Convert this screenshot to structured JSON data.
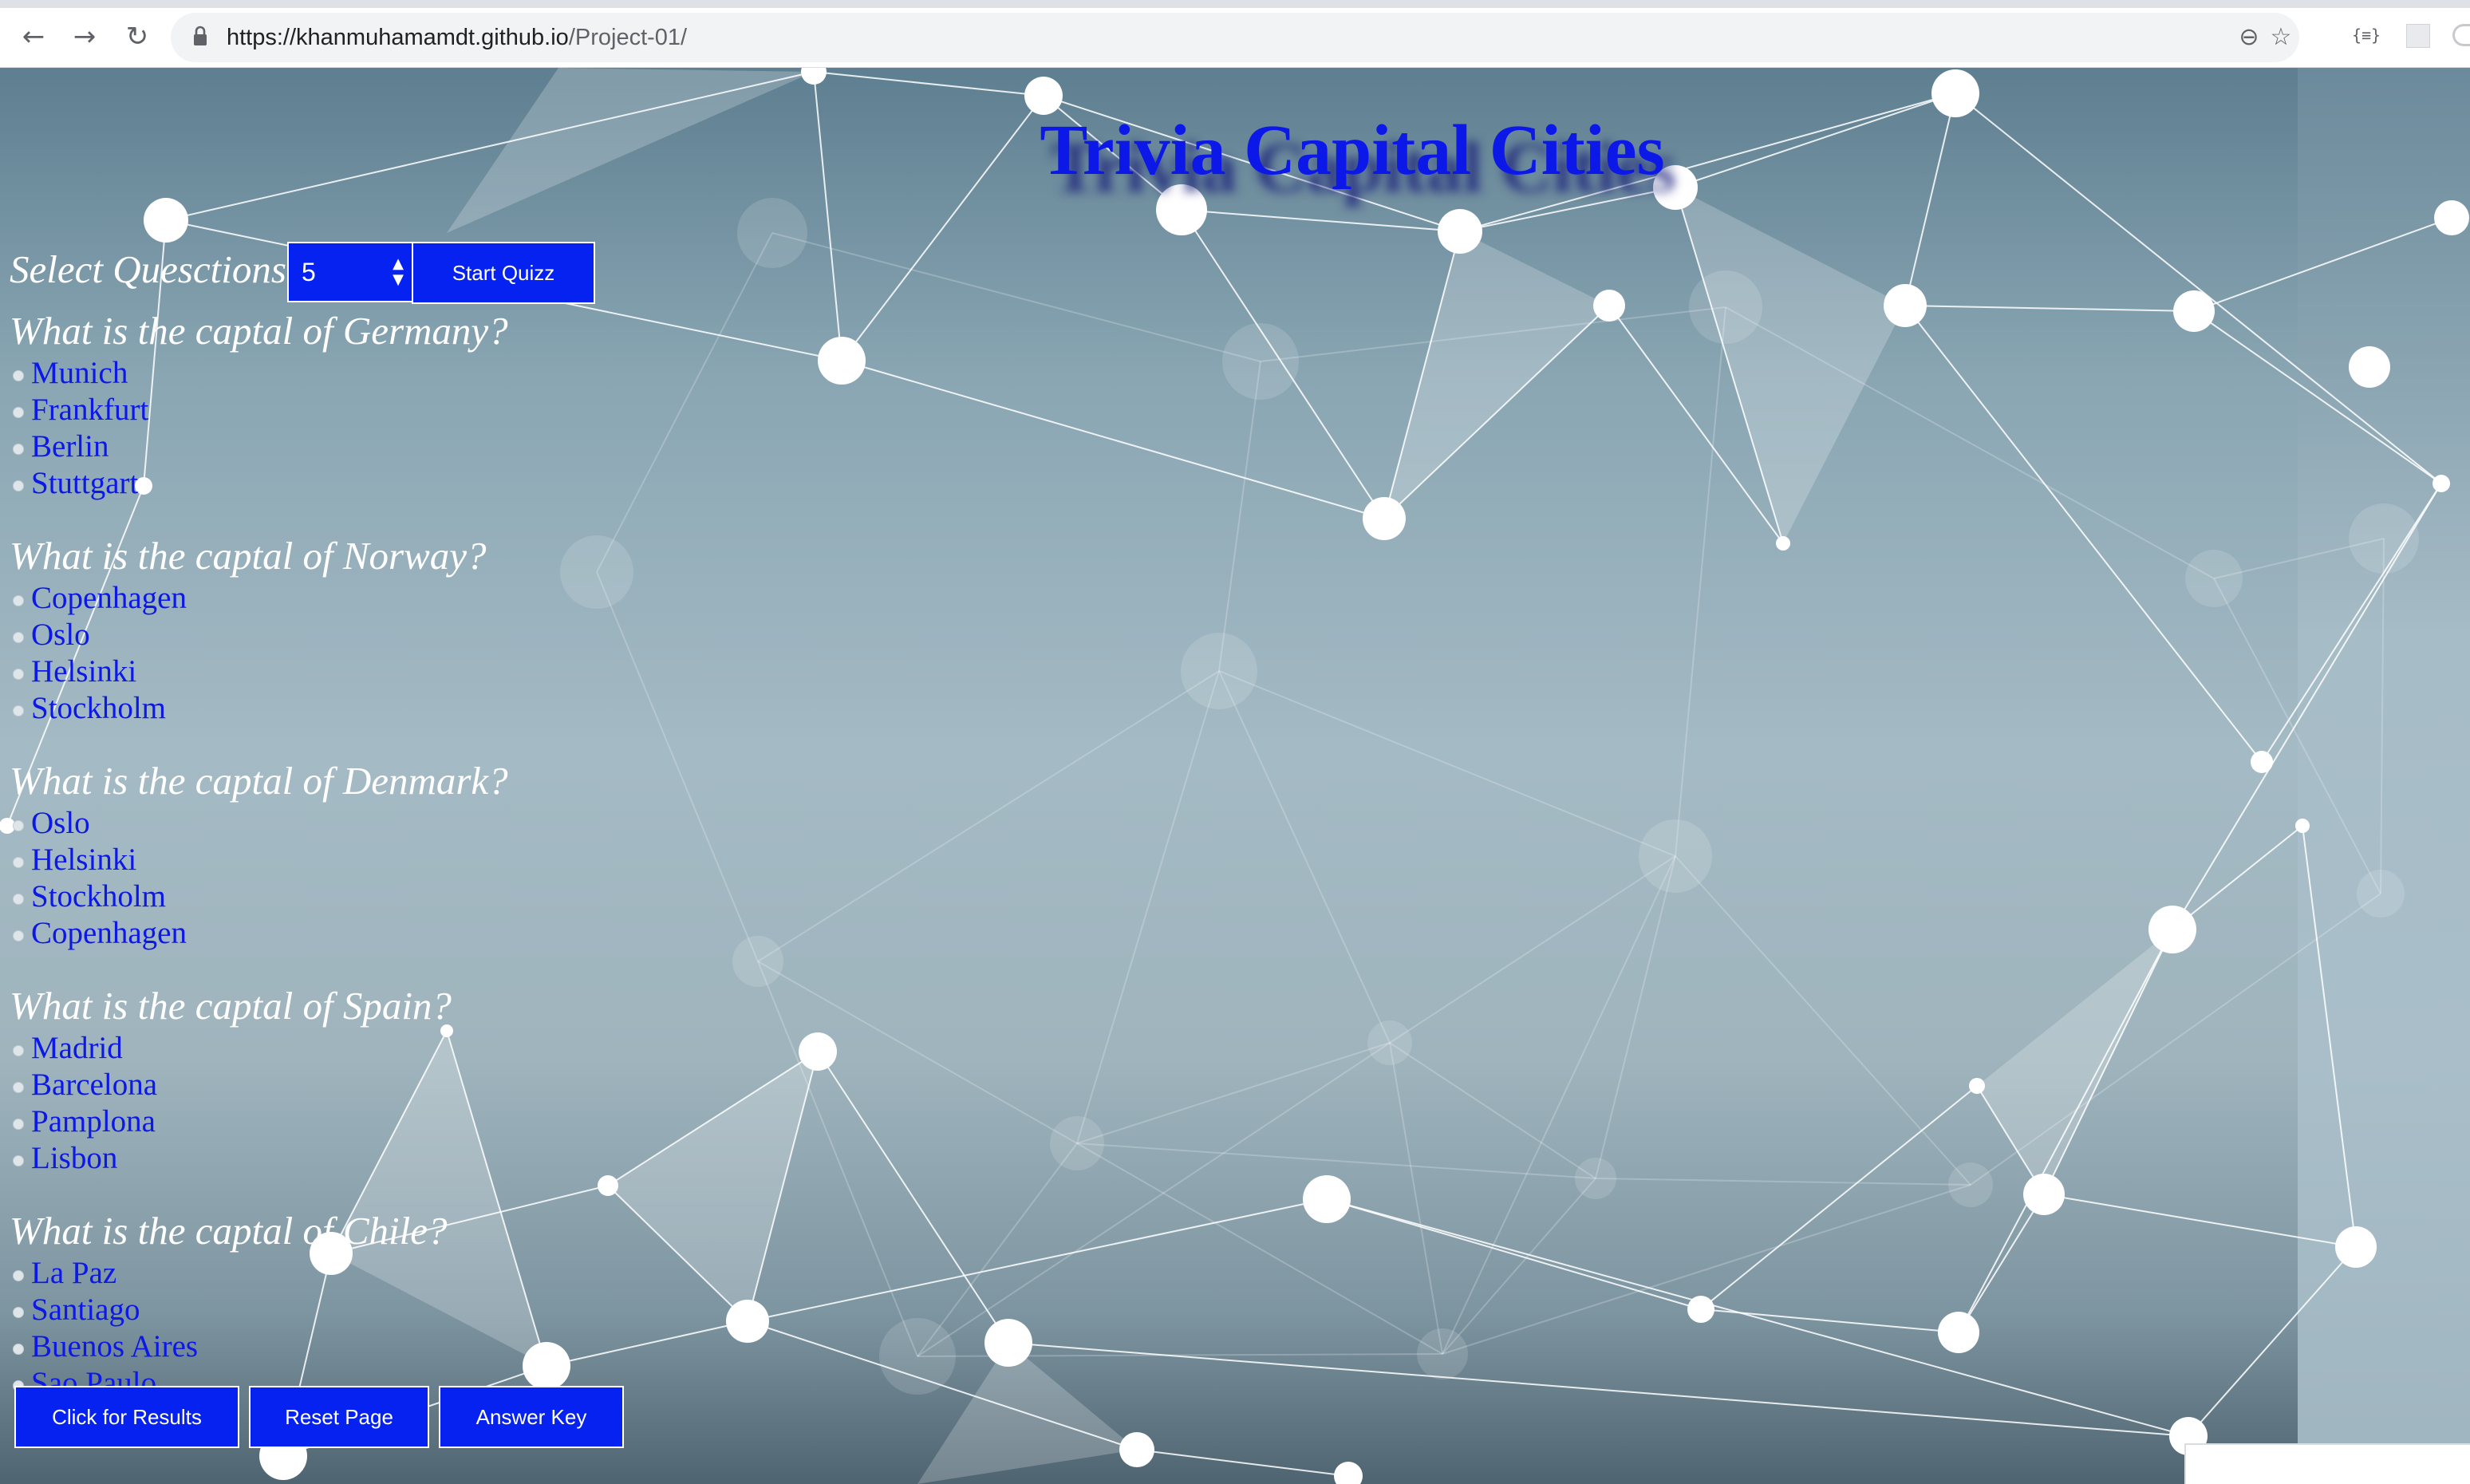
{
  "browser": {
    "url_host": "https://khanmuhamamdt.github.io",
    "url_path": "/Project-01/",
    "back_glyph": "←",
    "forward_glyph": "→",
    "reload_glyph": "↻",
    "zoom_glyph": "⊖",
    "star_glyph": "☆",
    "ext_label": "{≡}",
    "icons": [
      "back-arrow-icon",
      "forward-arrow-icon",
      "reload-icon",
      "lock-icon",
      "zoom-icon",
      "star-icon",
      "extension-icon"
    ]
  },
  "page": {
    "title": "Trivia Capital Cities",
    "select_label": "Select Quesctions",
    "question_count": "5",
    "start_label": "Start Quizz",
    "results_label": "Click for Results",
    "reset_label": "Reset Page",
    "answer_key_label": "Answer Key",
    "colors": {
      "accent_blue": "#0622f0",
      "title_blue": "#0b18e8",
      "question_text": "#ffffff"
    }
  },
  "questions": [
    {
      "text": "What is the captal of Germany?",
      "answers": [
        "Munich",
        "Frankfurt",
        "Berlin",
        "Stuttgart"
      ]
    },
    {
      "text": "What is the captal of Norway?",
      "answers": [
        "Copenhagen",
        "Oslo",
        "Helsinki",
        "Stockholm"
      ]
    },
    {
      "text": "What is the captal of Denmark?",
      "answers": [
        "Oslo",
        "Helsinki",
        "Stockholm",
        "Copenhagen"
      ]
    },
    {
      "text": "What is the captal of Spain?",
      "answers": [
        "Madrid",
        "Barcelona",
        "Pamplona",
        "Lisbon"
      ]
    },
    {
      "text": "What is the captal of Chile?",
      "answers": [
        "La Paz",
        "Santiago",
        "Buenos Aires",
        "Sao Paulo"
      ]
    }
  ]
}
